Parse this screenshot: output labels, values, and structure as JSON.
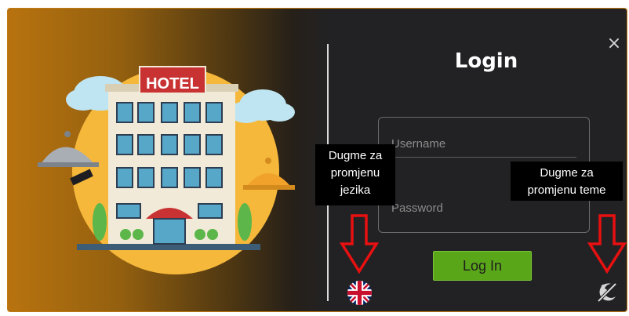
{
  "dialog": {
    "title": "Login",
    "close_icon": "×",
    "username_placeholder": "Username",
    "password_placeholder": "Password",
    "login_button": "Log In"
  },
  "illustration": {
    "hotel_sign": "HOTEL"
  },
  "annotations": {
    "language_tooltip": [
      "Dugme za",
      "promjenu",
      "jezika"
    ],
    "theme_tooltip": [
      "Dugme za",
      "promjenu teme"
    ]
  },
  "icons": {
    "close": "close-icon",
    "language": "uk-flag-icon",
    "theme": "theme-toggle-icon"
  },
  "colors": {
    "accent_orange": "#c07a12",
    "panel_dark": "#222224",
    "button_green": "#5aa619",
    "arrow_red": "#e81010"
  }
}
